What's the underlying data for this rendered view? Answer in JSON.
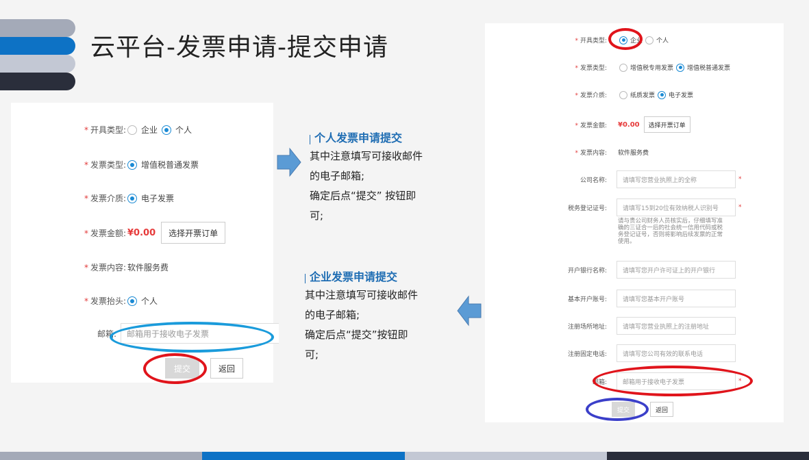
{
  "title": "云平台-发票申请-提交申请",
  "left_form": {
    "req_mark": "*",
    "rows": [
      {
        "label": "开具类型:",
        "options": [
          "企业",
          "个人"
        ],
        "selected": "个人"
      },
      {
        "label": "发票类型:",
        "options": [
          "增值税普通发票"
        ],
        "selected": "增值税普通发票"
      },
      {
        "label": "发票介质:",
        "options": [
          "电子发票"
        ],
        "selected": "电子发票"
      },
      {
        "label": "发票金额:",
        "price": "¥0.00",
        "button": "选择开票订单"
      },
      {
        "label": "发票内容:",
        "value": "软件服务费"
      },
      {
        "label": "发票抬头:",
        "options": [
          "个人"
        ],
        "selected": "个人"
      }
    ],
    "email_label": "邮箱:",
    "email_placeholder": "邮箱用于接收电子发票",
    "submit": "提交",
    "back": "返回"
  },
  "notes": {
    "personal": {
      "title": "个人发票申请提交",
      "lines": [
        "其中注意填写可接收邮件",
        "的电子邮箱;",
        "确定后点“提交” 按钮即",
        "可;"
      ]
    },
    "company": {
      "title": "企业发票申请提交",
      "lines": [
        "其中注意填写可接收邮件",
        "的电子邮箱;",
        "确定后点“提交”按钮即",
        "可;"
      ]
    }
  },
  "right_form": {
    "req_mark": "*",
    "type_label": "开具类型:",
    "type_options": [
      "企业",
      "个人"
    ],
    "invoice_type_label": "发票类型:",
    "invoice_type_options": [
      "增值税专用发票",
      "增值税普通发票"
    ],
    "medium_label": "发票介质:",
    "medium_options": [
      "纸质发票",
      "电子发票"
    ],
    "amount_label": "发票金额:",
    "amount": "¥0.00",
    "amount_button": "选择开票订单",
    "content_label": "发票内容:",
    "content_value": "软件服务费",
    "fields": [
      {
        "label": "公司名称:",
        "placeholder": "请填写您营业执照上的全称",
        "required": true
      },
      {
        "label": "税务登记证号:",
        "placeholder": "请填写15到20位有效纳税人识别号",
        "required": true
      },
      {
        "label": "开户银行名称:",
        "placeholder": "请填写您开户许可证上的开户银行",
        "required": false
      },
      {
        "label": "基本开户账号:",
        "placeholder": "请填写您基本开户账号",
        "required": false
      },
      {
        "label": "注册场所地址:",
        "placeholder": "请填写您营业执照上的注册地址",
        "required": false
      },
      {
        "label": "注册固定电话:",
        "placeholder": "请填写您公司有效的联系电话",
        "required": false
      },
      {
        "label": "邮箱:",
        "placeholder": "邮箱用于接收电子发票",
        "required": true
      }
    ],
    "tax_hint": [
      "请与贵公司财务人员核实后，仔细填写准",
      "确的三证合一后的社会统一信用代码或税",
      "务登记证号，否则将影响后续发票的正常",
      "使用。"
    ],
    "submit": "提交",
    "back": "返回"
  },
  "colors": {
    "stripe1": "#a4aab8",
    "stripe2": "#0d72c5",
    "stripe3": "#c3c8d4",
    "stripe4": "#2a2e3b",
    "highlight_red": "#e0141b",
    "highlight_cyan": "#1a9bdb",
    "highlight_blue": "#3b3fc9",
    "arrow_fill": "#5b9bd5",
    "note_title": "#1f6db3"
  }
}
